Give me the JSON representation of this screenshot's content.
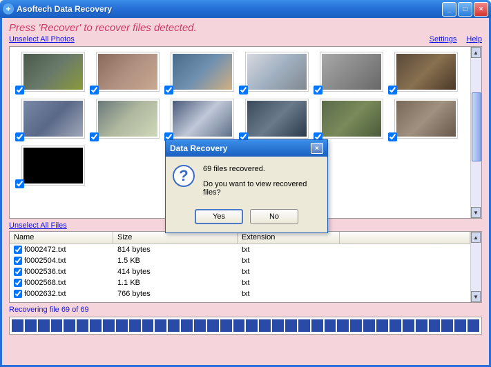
{
  "app": {
    "title": "Asoftech Data Recovery",
    "icon_glyph": "+"
  },
  "window_controls": {
    "minimize_glyph": "_",
    "maximize_glyph": "□",
    "close_glyph": "×"
  },
  "instruction": "Press 'Recover' to recover files detected.",
  "links": {
    "unselect_photos": "Unselect All Photos",
    "unselect_files": "Unselect All Files",
    "settings": "Settings",
    "help": "Help"
  },
  "photos": [
    {
      "checked": true
    },
    {
      "checked": true
    },
    {
      "checked": true
    },
    {
      "checked": true
    },
    {
      "checked": true
    },
    {
      "checked": true
    },
    {
      "checked": true
    },
    {
      "checked": true
    },
    {
      "checked": true
    },
    {
      "checked": true
    },
    {
      "checked": true
    },
    {
      "checked": true
    },
    {
      "checked": true
    }
  ],
  "file_table": {
    "columns": {
      "name": "Name",
      "size": "Size",
      "ext": "Extension"
    },
    "rows": [
      {
        "checked": true,
        "name": "f0002472.txt",
        "size": "814 bytes",
        "ext": "txt"
      },
      {
        "checked": true,
        "name": "f0002504.txt",
        "size": "1.5 KB",
        "ext": "txt"
      },
      {
        "checked": true,
        "name": "f0002536.txt",
        "size": "414 bytes",
        "ext": "txt"
      },
      {
        "checked": true,
        "name": "f0002568.txt",
        "size": "1.1 KB",
        "ext": "txt"
      },
      {
        "checked": true,
        "name": "f0002632.txt",
        "size": "766 bytes",
        "ext": "txt"
      }
    ]
  },
  "status": "Recovering file 69 of 69",
  "progress": {
    "blocks": 36
  },
  "dialog": {
    "title": "Data Recovery",
    "line1": "69 files recovered.",
    "line2": "Do you want to view recovered files?",
    "yes": "Yes",
    "no": "No",
    "close_glyph": "×",
    "question_glyph": "?"
  }
}
